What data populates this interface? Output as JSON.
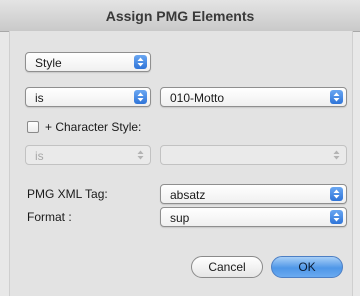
{
  "window": {
    "title": "Assign PMG Elements"
  },
  "style_popup": {
    "value": "Style"
  },
  "condition_popup": {
    "value": "is"
  },
  "motto_popup": {
    "value": "010-Motto"
  },
  "character_style": {
    "label": "+ Character Style:",
    "checked": false
  },
  "char_condition_popup": {
    "value": "is"
  },
  "char_value_popup": {
    "value": ""
  },
  "xml_tag": {
    "label": "PMG XML Tag:",
    "value": "absatz"
  },
  "format": {
    "label": "Format :",
    "value": "sup"
  },
  "buttons": {
    "cancel": "Cancel",
    "ok": "OK"
  },
  "colors": {
    "accent_blue": "#3d82e0",
    "window_bg": "#e8e8e8"
  }
}
